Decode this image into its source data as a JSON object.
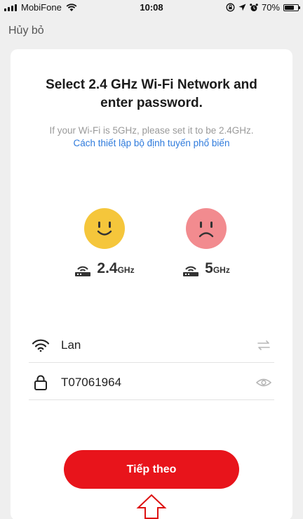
{
  "status_bar": {
    "carrier": "MobiFone",
    "time": "10:08",
    "battery": "70%",
    "battery_level": 0.7
  },
  "header": {
    "cancel_label": "Hủy bỏ"
  },
  "main": {
    "title": "Select 2.4 GHz Wi-Fi Network and enter password.",
    "hint": "If your Wi-Fi is 5GHz, please set it to be 2.4GHz.",
    "router_link": "Cách thiết lập bộ định tuyến phổ biến",
    "bands": [
      {
        "num": "2.4",
        "unit": "GHz",
        "face": "happy-face-icon",
        "color": "#f5c63b"
      },
      {
        "num": "5",
        "unit": "GHz",
        "face": "sad-face-icon",
        "color": "#f28b8f"
      }
    ],
    "ssid": "Lan",
    "password": "T07061964"
  },
  "footer": {
    "next_label": "Tiếp theo"
  },
  "colors": {
    "accent": "#e8141b",
    "link": "#2f7bdc"
  }
}
